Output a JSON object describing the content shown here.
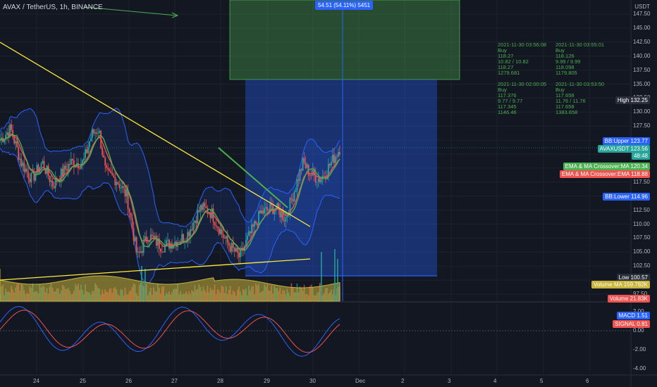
{
  "header": {
    "title": "AVAX / TetherUS, 1h, BINANCE",
    "currency": "USDT"
  },
  "range_label": "54.51 (54.11%) 5451",
  "price_axis": [
    "147.50",
    "145.00",
    "142.50",
    "140.00",
    "137.50",
    "135.00",
    "132.50",
    "130.00",
    "127.50",
    "125.00",
    "122.50",
    "120.00",
    "117.50",
    "115.00",
    "112.50",
    "110.00",
    "107.50",
    "105.00",
    "102.50",
    "100.00",
    "97.50"
  ],
  "macd_axis": [
    "2.00",
    "0.00",
    "-2.00",
    "-4.00"
  ],
  "x_axis": [
    "24",
    "25",
    "26",
    "27",
    "28",
    "29",
    "30",
    "Dec",
    "2",
    "3",
    "4",
    "5",
    "6"
  ],
  "badges": {
    "high": {
      "label": "High",
      "value": "132.25"
    },
    "bb_upper": {
      "label": "BB:Upper",
      "value": "123.77"
    },
    "avaxusdt": {
      "label": "AVAXUSDT",
      "value": "123.56",
      "sub": "48:48"
    },
    "ema_ma": {
      "label": "EMA & MA Crossover:MA",
      "value": "120.34"
    },
    "ema_ema": {
      "label": "EMA & MA Crossover:EMA",
      "value": "118.88"
    },
    "bb_lower": {
      "label": "BB:Lower",
      "value": "114.96"
    },
    "low": {
      "label": "Low",
      "value": "100.57"
    },
    "volume_ma": {
      "label": "Volume MA",
      "value": "159.782K"
    },
    "volume": {
      "label": "Volume",
      "value": "21.83K"
    },
    "macd": {
      "label": "MACD",
      "value": "1.51"
    },
    "signal": {
      "label": "SIGNAL",
      "value": "0.81"
    }
  },
  "trades": [
    {
      "text": "2021-11-30 03:56:08\nBuy\n118.27\n10.82 / 10.82\n118.27\n1279.681"
    },
    {
      "text": "2021-11-30 03:55:01\nBuy\n118.126\n9.99 / 9.99\n118.098\n1179.805"
    },
    {
      "text": "2021-11-30 02:00:05\nBuy\n117.376\n9.77 / 9.77\n117.345\n1146.46"
    },
    {
      "text": "2021-11-30 03:53:50\nBuy\n117.658\n11.76 / 11.76\n117.658\n1383.658"
    }
  ],
  "colors": {
    "up": "#26a69a",
    "down": "#ef5350",
    "bb": "#2962ff",
    "ema": "#ef5350",
    "ma": "#4caf50",
    "trend": "#ffeb3b",
    "volume": "#c9b53a",
    "macd": "#2962ff",
    "signal": "#ef5350"
  },
  "chart_data": {
    "type": "line",
    "title": "AVAX / TetherUS, 1h, BINANCE",
    "ylim": [
      96,
      149
    ],
    "x": [
      "24",
      "25",
      "26",
      "27",
      "28",
      "29",
      "30"
    ],
    "series": [
      {
        "name": "AVAXUSDT",
        "values": [
          125.5,
          122,
          128,
          112,
          107.5,
          113,
          123.56
        ]
      },
      {
        "name": "BB:Upper",
        "values": [
          131,
          124,
          130,
          118,
          113,
          121,
          123.77
        ]
      },
      {
        "name": "BB:Lower",
        "values": [
          120,
          114,
          121,
          104,
          102,
          107,
          114.96
        ]
      },
      {
        "name": "EMA & MA Crossover:MA",
        "values": [
          125,
          121,
          126,
          114,
          108,
          112,
          120.34
        ]
      },
      {
        "name": "EMA & MA Crossover:EMA",
        "values": [
          125.5,
          120,
          125,
          113,
          108,
          112,
          118.88
        ]
      },
      {
        "name": "Volume",
        "values": [
          159782,
          150000,
          140000,
          165000,
          155000,
          145000,
          21830
        ]
      },
      {
        "name": "MACD",
        "values": [
          1.5,
          -1.5,
          1,
          -2,
          -1,
          1.5,
          1.51
        ]
      },
      {
        "name": "SIGNAL",
        "values": [
          1,
          -1,
          0.5,
          -1.5,
          -1,
          1,
          0.81
        ]
      }
    ]
  }
}
